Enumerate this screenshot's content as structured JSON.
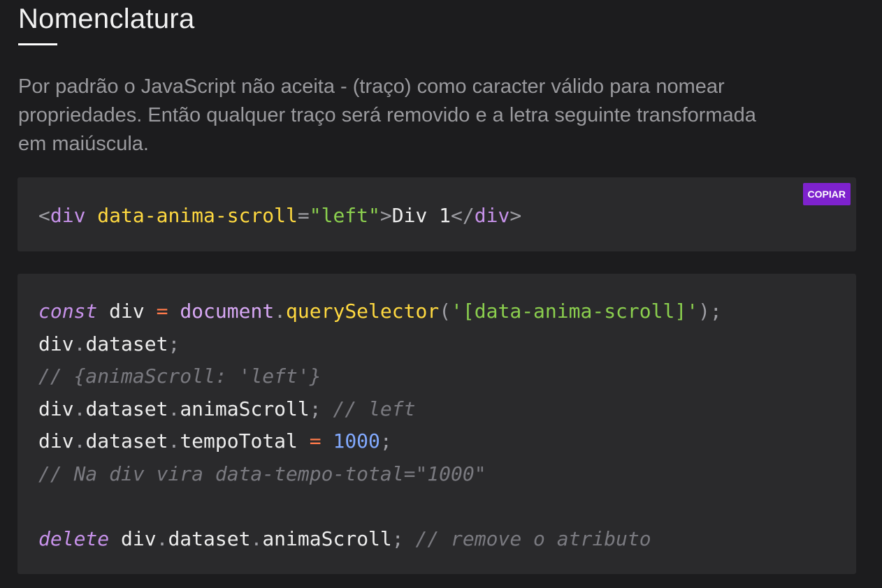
{
  "heading": {
    "title": "Nomenclatura",
    "description": "Por padrão o JavaScript não aceita - (traço) como caracter válido para nomear propriedades. Então qualquer traço será removido e a letra seguinte transformada em maiúscula."
  },
  "code_block_1": {
    "copy_label": "COPIAR",
    "line": {
      "t1": "<",
      "t2": "div",
      "t3": " ",
      "t4": "data-anima-scroll",
      "t5": "=",
      "t6": "\"left\"",
      "t7": ">",
      "t8": "Div 1",
      "t9": "</",
      "t10": "div",
      "t11": ">"
    }
  },
  "code_block_2": {
    "lines": [
      {
        "t1": "const",
        "t2": " div ",
        "t3": "=",
        "t4": " ",
        "t5": "document",
        "t6": ".",
        "t7": "querySelector",
        "t8": "(",
        "t9": "'[data-anima-scroll]'",
        "t10": ");"
      },
      {
        "t1": "div",
        "t2": ".",
        "t3": "dataset",
        "t4": ";"
      },
      {
        "t1": "// {animaScroll: 'left'}"
      },
      {
        "t1": "div",
        "t2": ".",
        "t3": "dataset",
        "t4": ".",
        "t5": "animaScroll",
        "t6": ";",
        "t7": " // left"
      },
      {
        "t1": "div",
        "t2": ".",
        "t3": "dataset",
        "t4": ".",
        "t5": "tempoTotal",
        "t6": " ",
        "t7": "=",
        "t8": " ",
        "t9": "1000",
        "t10": ";"
      },
      {
        "t1": "// Na div vira data-tempo-total=\"1000\""
      },
      {
        "t1": ""
      },
      {
        "t1": "delete",
        "t2": " div",
        "t3": ".",
        "t4": "dataset",
        "t5": ".",
        "t6": "animaScroll",
        "t7": ";",
        "t8": " // remove o atributo"
      }
    ]
  },
  "colors": {
    "background": "#1c1c1e",
    "code_background": "#2a2a2c",
    "copy_button": "#7e22ce",
    "keyword": "#c792ea",
    "function": "#ffd940",
    "string": "#8bcf4e",
    "number": "#82aaff",
    "operator": "#ff7a4a",
    "comment": "#7a7a80"
  }
}
